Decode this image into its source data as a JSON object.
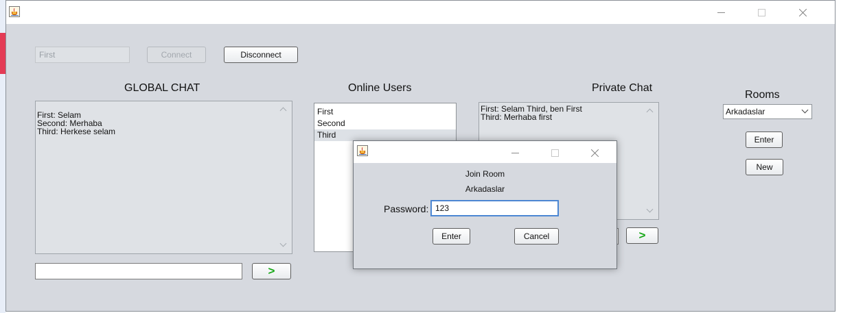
{
  "window": {
    "icon": "java-cup-icon"
  },
  "top": {
    "name_value": "First",
    "connect_label": "Connect",
    "disconnect_label": "Disconnect"
  },
  "global_chat": {
    "heading": "GLOBAL CHAT",
    "messages": [
      "First: Selam",
      "Second: Merhaba",
      "Third: Herkese selam"
    ],
    "input_value": "",
    "send_label": ">"
  },
  "online_users": {
    "heading": "Online Users",
    "users": [
      "First",
      "Second",
      "Third"
    ],
    "selected": "Third"
  },
  "private_chat": {
    "heading": "Private Chat",
    "messages": [
      "First: Selam Third, ben First",
      "Third: Merhaba first"
    ],
    "send_label": ">"
  },
  "rooms": {
    "heading": "Rooms",
    "selected_room": "Arkadaslar",
    "enter_label": "Enter",
    "new_label": "New"
  },
  "dialog": {
    "title_line": "Join Room",
    "room_name": "Arkadaslar",
    "password_label": "Password:",
    "password_value": "123",
    "enter_label": "Enter",
    "cancel_label": "Cancel"
  },
  "colors": {
    "window_bg": "#d6d9df",
    "send_arrow": "#18a818",
    "focus_border": "#4b86d3",
    "list_selection": "#dde1e6"
  }
}
